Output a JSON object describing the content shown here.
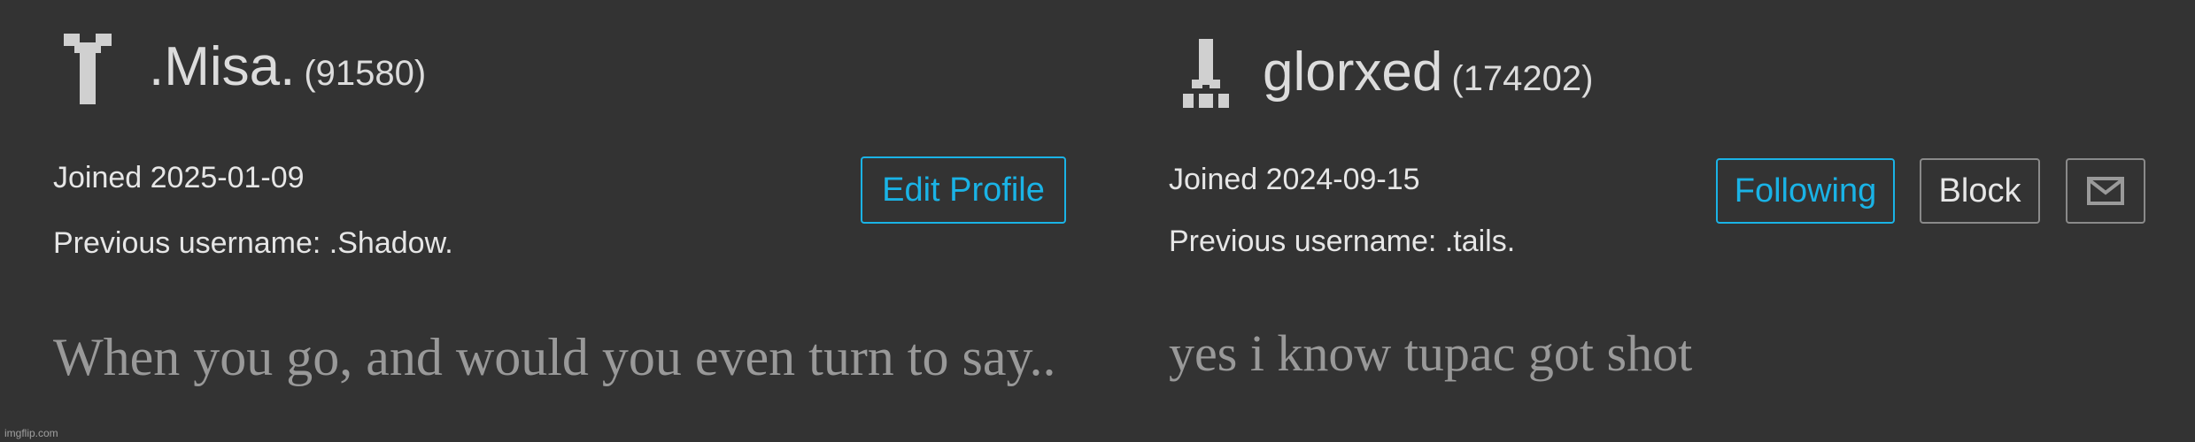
{
  "theme": {
    "background": "#333333",
    "text": "#e6e6e6",
    "accent": "#1ab3e6",
    "muted_text": "#999999",
    "button_border": "#8a8a8a"
  },
  "profiles": [
    {
      "avatar_icon": "pixel-avatar-icon",
      "username": ".Misa.",
      "user_id": "(91580)",
      "joined": "Joined 2025-01-09",
      "previous_username": "Previous username: .Shadow.",
      "bio": "When you go, and would you even turn to say..",
      "actions": {
        "edit_label": "Edit Profile"
      }
    },
    {
      "avatar_icon": "pixel-avatar-icon",
      "username": "glorxed",
      "user_id": "(174202)",
      "joined": "Joined 2024-09-15",
      "previous_username": "Previous username: .tails.",
      "bio": "yes i know tupac got shot",
      "actions": {
        "following_label": "Following",
        "block_label": "Block",
        "message_icon": "mail-icon"
      }
    }
  ],
  "watermark": "imgflip.com"
}
